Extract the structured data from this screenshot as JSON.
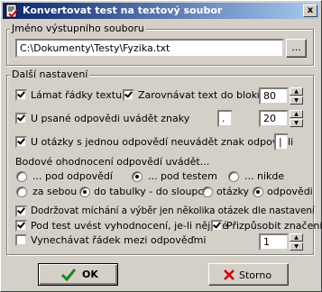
{
  "window": {
    "title": "Konvertovat test na textový soubor",
    "close_symbol": "x"
  },
  "output_group": {
    "legend": "Jméno výstupního souboru",
    "file_path": "C:\\Dokumenty\\Testy\\Fyzika.txt",
    "browse_label": "..."
  },
  "settings_group": {
    "legend": "Další nastavení",
    "wrap_lines": {
      "label": "Lámat řádky textu",
      "checked": true
    },
    "align_blocks": {
      "label": "Zarovnávat text do bloků",
      "checked": true,
      "value": "80"
    },
    "written_answer_chars": {
      "label": "U psané odpovědi uvádět znaky",
      "checked": true,
      "char_value": ".",
      "count_value": "20"
    },
    "single_answer_question": {
      "label": "U otázky s jednou odpovědí neuvádět znak odpovědi",
      "checked": true,
      "value": "|"
    },
    "scoring_heading": "Bodové ohodnocení odpovědí uvádět...",
    "scoring_position": [
      {
        "label": "... pod odpovědí",
        "selected": false
      },
      {
        "label": "... pod testem",
        "selected": true
      },
      {
        "label": "... nikde",
        "selected": false
      }
    ],
    "scoring_layout": [
      {
        "label": "za sebou",
        "selected": false
      },
      {
        "label": "do tabulky - do sloupců:",
        "selected": true
      },
      {
        "label": "otázky",
        "selected": false
      },
      {
        "label": "odpovědi",
        "selected": true
      }
    ],
    "keep_shuffle": {
      "label": "Dodržovat míchání a výběr jen několika otázek dle nastavení",
      "checked": true
    },
    "evaluation_below": {
      "label": "Pod test uvést vyhodnocení, je-li nějaké",
      "checked": true
    },
    "adjust_chars": {
      "label": "Přizpůsobit značení",
      "checked": true
    },
    "skip_line": {
      "label": "Vynechávat řádek mezi odpověďmi",
      "checked": false,
      "value": "1"
    }
  },
  "buttons": {
    "ok": "OK",
    "cancel": "Storno"
  },
  "colors": {
    "titlebar_start": "#0a246a",
    "titlebar_end": "#a6caf0",
    "ok_check": "#1a8a1a",
    "cancel_x": "#cc0000"
  }
}
